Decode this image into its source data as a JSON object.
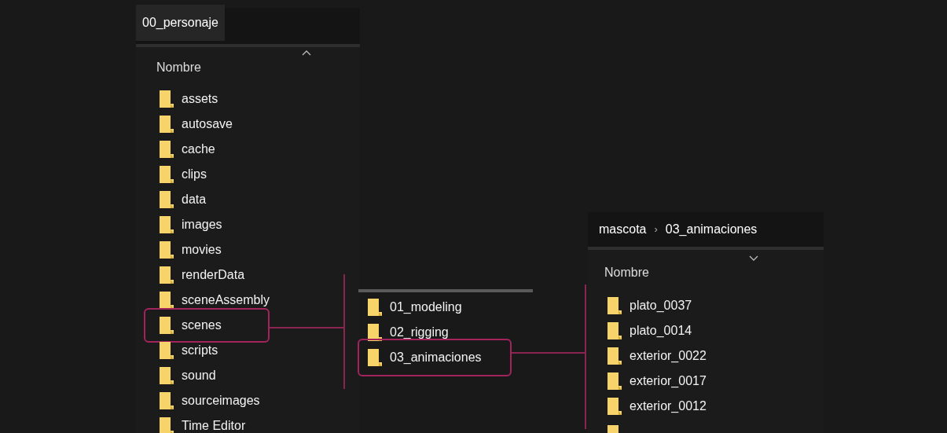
{
  "left_window": {
    "tab": "00_personaje",
    "column_header": "Nombre",
    "sort_ascending": true,
    "items": [
      {
        "name": "assets",
        "selected": false
      },
      {
        "name": "autosave",
        "selected": false
      },
      {
        "name": "cache",
        "selected": false
      },
      {
        "name": "clips",
        "selected": false
      },
      {
        "name": "data",
        "selected": false
      },
      {
        "name": "images",
        "selected": false
      },
      {
        "name": "movies",
        "selected": false
      },
      {
        "name": "renderData",
        "selected": false
      },
      {
        "name": "sceneAssembly",
        "selected": false
      },
      {
        "name": "scenes",
        "selected": true
      },
      {
        "name": "scripts",
        "selected": false
      },
      {
        "name": "sound",
        "selected": false
      },
      {
        "name": "sourceimages",
        "selected": false
      },
      {
        "name": "Time Editor",
        "selected": false
      }
    ]
  },
  "middle_list": {
    "items": [
      {
        "name": "01_modeling",
        "selected": false
      },
      {
        "name": "02_rigging",
        "selected": false
      },
      {
        "name": "03_animaciones",
        "selected": true
      }
    ]
  },
  "right_window": {
    "breadcrumb": [
      "mascota",
      "03_animaciones"
    ],
    "breadcrumb_separator": "›",
    "column_header": "Nombre",
    "sort_ascending": false,
    "more_below": true,
    "items": [
      {
        "name": "plato_0037",
        "selected": false
      },
      {
        "name": "plato_0014",
        "selected": false
      },
      {
        "name": "exterior_0022",
        "selected": false
      },
      {
        "name": "exterior_0017",
        "selected": false
      },
      {
        "name": "exterior_0012",
        "selected": false
      }
    ]
  }
}
